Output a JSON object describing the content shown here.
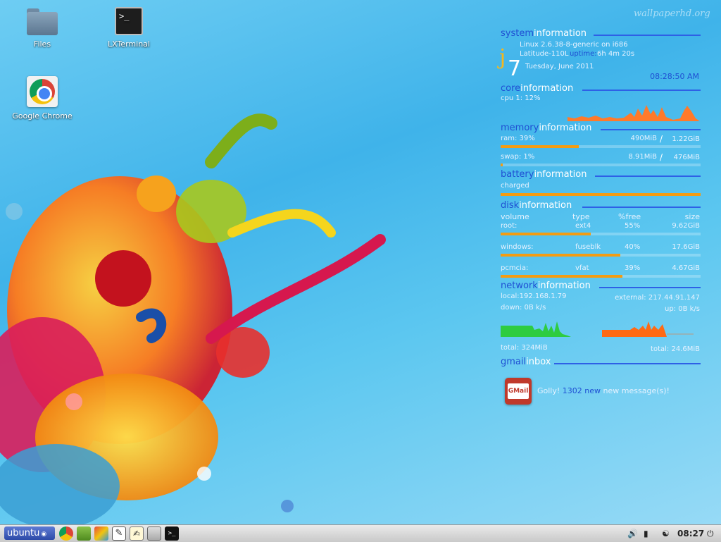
{
  "wallpaper": {
    "watermark": "wallpaperhd.org"
  },
  "desktop_icons": [
    {
      "label": "Files",
      "icon": "folder-icon"
    },
    {
      "label": "LXTerminal",
      "icon": "terminal-icon"
    },
    {
      "label": "Google Chrome",
      "icon": "chrome-icon"
    }
  ],
  "conky": {
    "system": {
      "title_a": "system",
      "title_b": "information",
      "kernel": "Linux 2.6.38-8-generic on i686",
      "host": "Latitude-110L",
      "uptime_label": "uptime:",
      "uptime": "6h 4m 20s",
      "day_glyph": "j",
      "day_number": "7",
      "date": "Tuesday, June 2011",
      "time": "08:28:50 AM"
    },
    "core": {
      "title_a": "core",
      "title_b": "information",
      "cpu": "cpu 1: 12%"
    },
    "memory": {
      "title_a": "memory",
      "title_b": "information",
      "ram_label": "ram: 39%",
      "ram_used": "490MiB",
      "ram_sep": "/",
      "ram_total": "1.22GiB",
      "ram_fill": 0.39,
      "swap_label": "swap: 1%",
      "swap_used": "8.91MiB",
      "swap_sep": "/",
      "swap_total": "476MiB",
      "swap_fill": 0.01
    },
    "battery": {
      "title_a": "battery",
      "title_b": "information",
      "status": "charged",
      "fill": 1.0
    },
    "disk": {
      "title_a": "disk",
      "title_b": "information",
      "headers": {
        "volume": "volume",
        "type": "type",
        "free": "%free",
        "size": "size"
      },
      "rows": [
        {
          "volume": "root:",
          "type": "ext4",
          "free": "55%",
          "size": "9.62GiB",
          "used_fill": 0.45
        },
        {
          "volume": "windows:",
          "type": "fuseblk",
          "free": "40%",
          "size": "17.6GiB",
          "used_fill": 0.6
        },
        {
          "volume": "pcmcia:",
          "type": "vfat",
          "free": "39%",
          "size": "4.67GiB",
          "used_fill": 0.61
        }
      ]
    },
    "network": {
      "title_a": "network",
      "title_b": "information",
      "local": "local:192.168.1.79",
      "external": "external: 217.44.91.147",
      "down": "down: 0B  k/s",
      "up": "up: 0B  k/s",
      "total_down": "total: 324MiB",
      "total_up": "total: 24.6MiB"
    },
    "gmail": {
      "title_a": "gmail",
      "title_b": "inbox",
      "icon_text": "GMail",
      "msg_a": "Golly!",
      "count": "1302",
      "new_word": "new",
      "msg_b": "new message(s)!"
    }
  },
  "taskbar": {
    "start_label": "ubuntu",
    "launchers": [
      "chrome-icon",
      "leaf-icon",
      "paint-icon",
      "inkscape-icon",
      "notes-icon",
      "files-icon",
      "terminal-icon"
    ],
    "clock": "08:27"
  },
  "colors": {
    "accent_blue": "#1f4fd3",
    "bar_orange": "#f39c12",
    "net_down": "#2ecc40",
    "net_up": "#ff6a14",
    "cpu_graph": "#ff7a2a"
  }
}
